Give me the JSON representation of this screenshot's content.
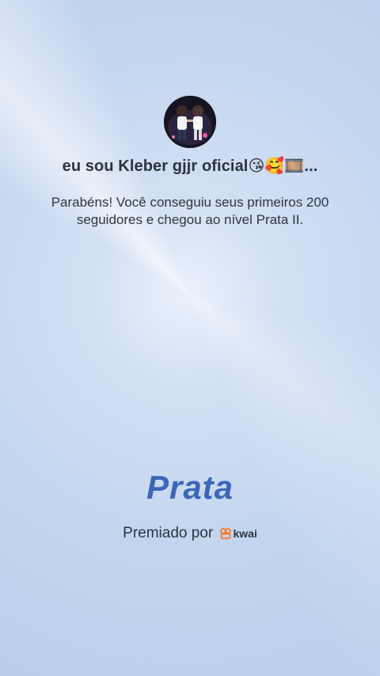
{
  "profile": {
    "username": "eu sou Kleber gjjr oficial😘🥰🎞️...",
    "avatar_icon": "avatar-icon"
  },
  "achievement": {
    "message": "Parabéns! Você conseguiu seus primeiros 200 seguidores e chegou ao nível Prata II.",
    "level_title": "Prata"
  },
  "footer": {
    "awarded_by": "Premiado por",
    "brand_name": "kwai",
    "brand_color": "#ff6a00"
  }
}
